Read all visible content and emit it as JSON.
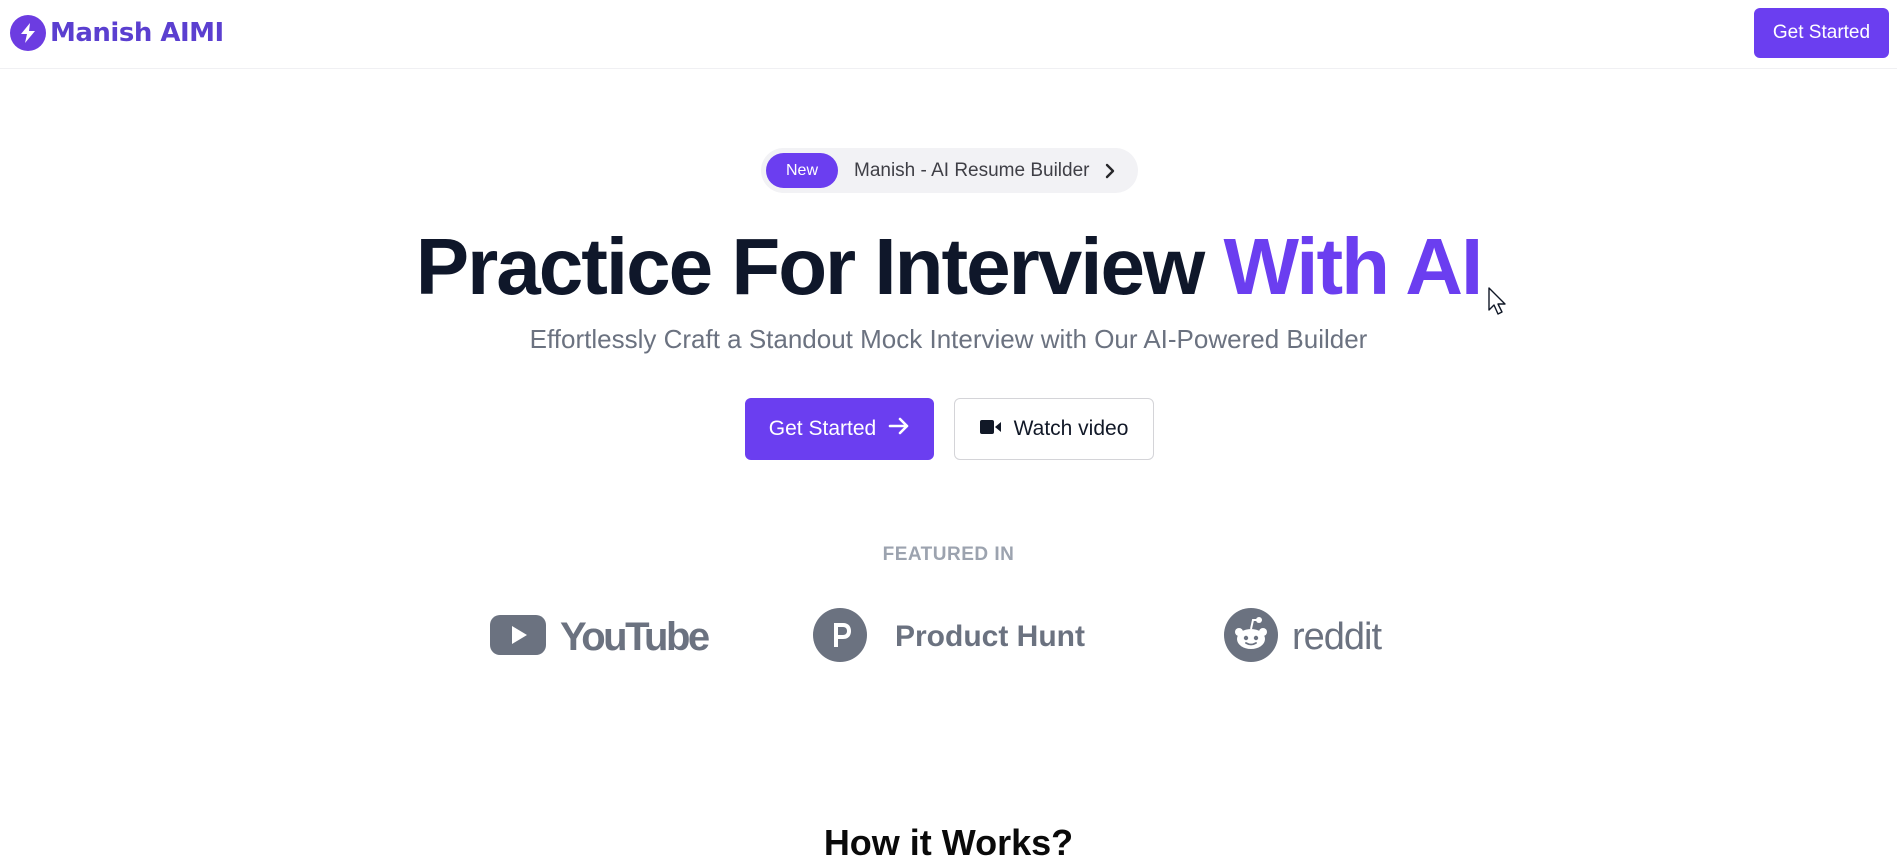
{
  "brand": {
    "name": "Manish AIMI",
    "accent": "#6b3ef0",
    "logo_icon": "lightning-bolt-icon"
  },
  "header": {
    "cta_label": "Get Started"
  },
  "announcement": {
    "badge": "New",
    "text": "Manish - AI Resume Builder",
    "icon": "chevron-right-icon"
  },
  "hero": {
    "title_main": "Practice For Interview ",
    "title_accent": "With AI",
    "subtitle": "Effortlessly Craft a Standout Mock Interview with Our AI-Powered Builder",
    "primary_cta": "Get Started",
    "primary_cta_icon": "arrow-right-icon",
    "secondary_cta": "Watch video",
    "secondary_cta_icon": "video-camera-icon"
  },
  "featured": {
    "label": "FEATURED IN",
    "brands": [
      {
        "name": "YouTube",
        "text": "YouTube",
        "icon": "youtube-icon"
      },
      {
        "name": "Product Hunt",
        "text": "Product Hunt",
        "icon": "product-hunt-icon"
      },
      {
        "name": "reddit",
        "text": "reddit",
        "icon": "reddit-icon"
      }
    ]
  },
  "how_it_works": {
    "title": "How it Works?"
  }
}
